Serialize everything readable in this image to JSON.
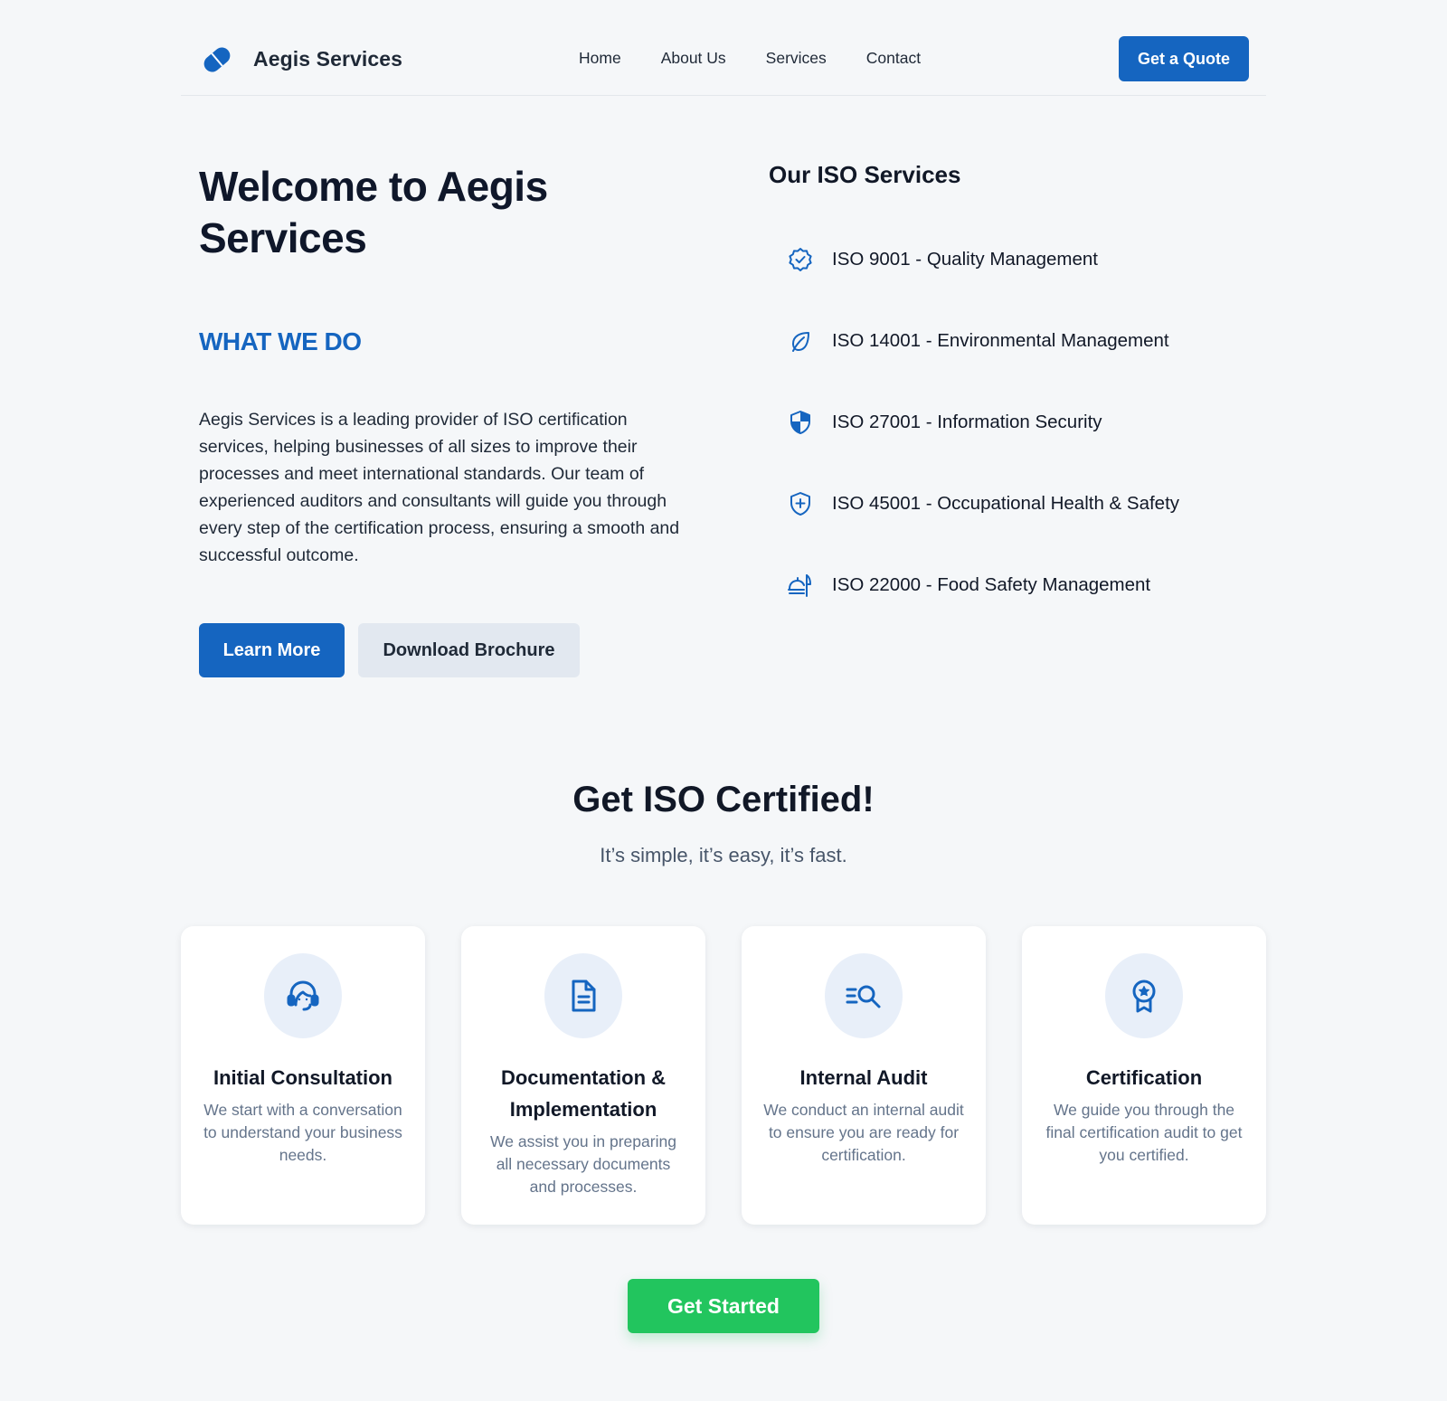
{
  "colors": {
    "primary": "#1565c0",
    "success": "#22c55e",
    "background": "#f5f7f9",
    "icon_bg": "#e8eff9"
  },
  "header": {
    "logo_icon": "pill-tag-icon",
    "brand": "Aegis Services",
    "nav": [
      "Home",
      "About Us",
      "Services",
      "Contact"
    ],
    "cta": "Get a Quote"
  },
  "hero": {
    "title": "Welcome to Aegis Services",
    "eyebrow": "WHAT WE DO",
    "description": "Aegis Services is a leading provider of ISO certification services, helping businesses of all sizes to improve their processes and meet international standards. Our team of experienced auditors and consultants will guide you through every step of the certification process, ensuring a smooth and successful outcome.",
    "primary_button": "Learn More",
    "secondary_button": "Download Brochure"
  },
  "iso_services": {
    "title": "Our ISO Services",
    "items": [
      {
        "label": "ISO 9001 - Quality Management",
        "icon": "verified-badge-icon"
      },
      {
        "label": "ISO 14001 - Environmental Management",
        "icon": "leaf-icon"
      },
      {
        "label": "ISO 27001 - Information Security",
        "icon": "shield-icon"
      },
      {
        "label": "ISO 45001 - Occupational Health & Safety",
        "icon": "shield-plus-icon"
      },
      {
        "label": "ISO 22000 - Food Safety Management",
        "icon": "food-service-icon"
      }
    ]
  },
  "certified": {
    "heading": "Get ISO Certified!",
    "subheading": "It’s simple, it’s easy, it’s fast.",
    "steps": [
      {
        "title": "Initial Consultation",
        "text": "We start with a conversation to understand your business needs.",
        "icon": "headset-icon"
      },
      {
        "title": "Documentation & Implementation",
        "text": "We assist you in preparing all necessary documents and processes.",
        "icon": "document-icon"
      },
      {
        "title": "Internal Audit",
        "text": "We conduct an internal audit to ensure you are ready for certification.",
        "icon": "search-list-icon"
      },
      {
        "title": "Certification",
        "text": "We guide you through the final certification audit to get you certified.",
        "icon": "award-icon"
      }
    ],
    "cta": "Get Started"
  }
}
